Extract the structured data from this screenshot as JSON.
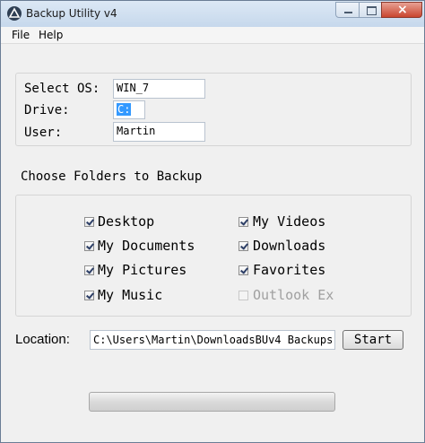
{
  "window": {
    "title": "Backup Utility v4",
    "close_glyph": "×"
  },
  "menu": {
    "items": [
      "File",
      "Help"
    ]
  },
  "settings": {
    "os_label": "Select OS:",
    "os_value": "WIN_7",
    "drive_label": "Drive:",
    "drive_value": "C:",
    "user_label": "User:",
    "user_value": "Martin"
  },
  "folders": {
    "heading": "Choose Folders to Backup",
    "items": [
      {
        "label": "Desktop",
        "checked": true,
        "enabled": true
      },
      {
        "label": "My Documents",
        "checked": true,
        "enabled": true
      },
      {
        "label": "My Pictures",
        "checked": true,
        "enabled": true
      },
      {
        "label": "My Music",
        "checked": true,
        "enabled": true
      },
      {
        "label": "My Videos",
        "checked": true,
        "enabled": true
      },
      {
        "label": "Downloads",
        "checked": true,
        "enabled": true
      },
      {
        "label": "Favorites",
        "checked": true,
        "enabled": true
      },
      {
        "label": "Outlook Ex",
        "checked": false,
        "enabled": false
      }
    ]
  },
  "location": {
    "label": "Location:",
    "value": "C:\\Users\\Martin\\DownloadsBUv4 Backups"
  },
  "actions": {
    "start_label": "Start"
  },
  "progress": {
    "value": 0
  }
}
